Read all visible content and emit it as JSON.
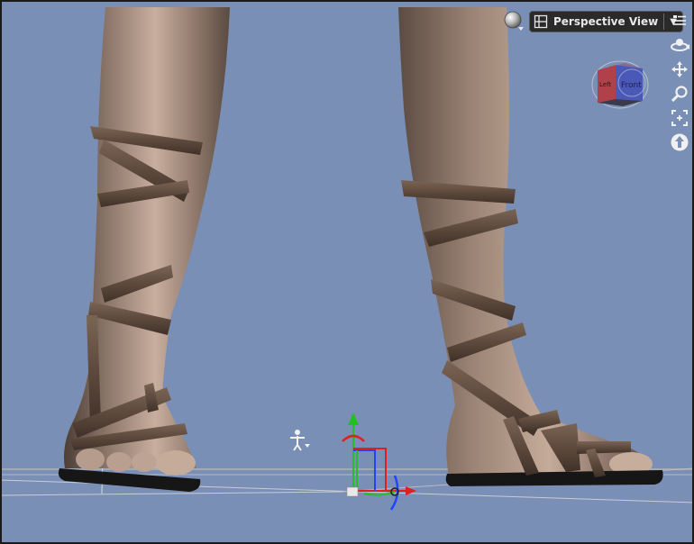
{
  "viewport": {
    "view_name": "Perspective View",
    "background_color": "#7a8fb6"
  },
  "viewcube": {
    "front_label": "Front",
    "left_label": "Left"
  },
  "icons": {
    "render_ball": "render-mode-sphere-icon",
    "view_grid": "layout-grid-icon",
    "dropdown": "chevron-down-icon",
    "menu": "viewport-menu-icon",
    "orbit": "orbit-icon",
    "pan": "pan-arrows-icon",
    "zoom": "zoom-magnifier-icon",
    "frame": "frame-selection-icon",
    "reset": "reset-view-icon",
    "figure": "figure-pose-icon"
  }
}
